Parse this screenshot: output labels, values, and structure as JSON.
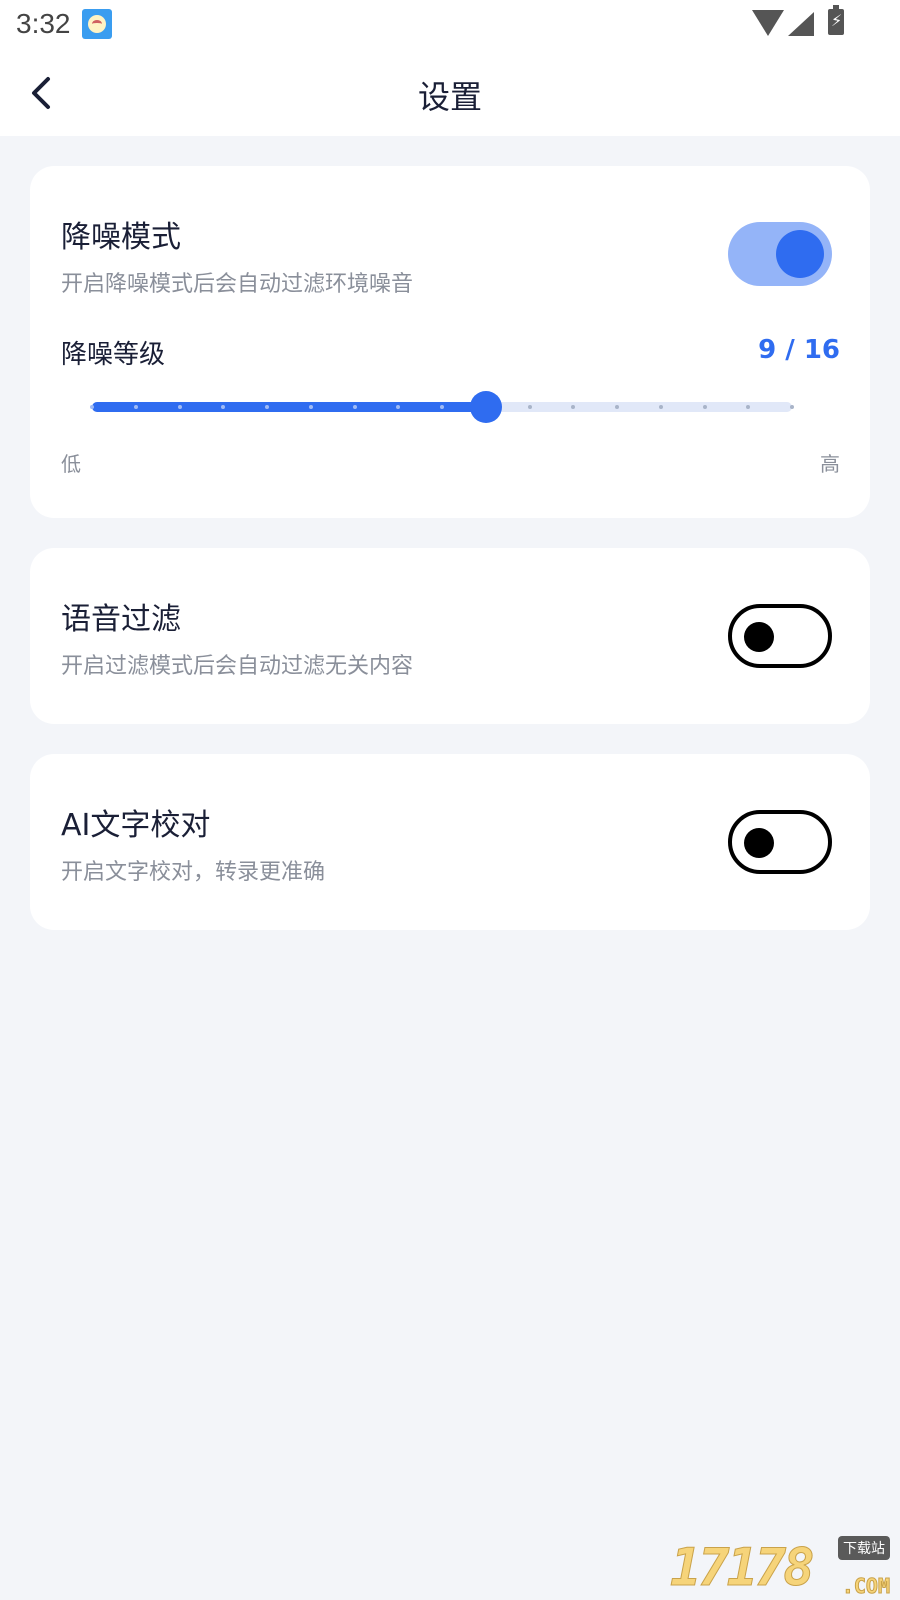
{
  "status_bar": {
    "time": "3:32",
    "app_icon": "bird-app-icon",
    "battery_symbol": "⚡"
  },
  "header": {
    "title": "设置",
    "back_icon": "chevron-left-icon"
  },
  "noise_reduction": {
    "title": "降噪模式",
    "description": "开启降噪模式后会自动过滤环境噪音",
    "enabled": true,
    "level_label": "降噪等级",
    "level_text": "9 / 16",
    "level": 9,
    "level_max": 16,
    "low_label": "低",
    "high_label": "高"
  },
  "voice_filter": {
    "title": "语音过滤",
    "description": "开启过滤模式后会自动过滤无关内容",
    "enabled": false
  },
  "ai_proofread": {
    "title": "AI文字校对",
    "description": "开启文字校对，转录更准确",
    "enabled": false
  },
  "watermark": {
    "digits": "17178",
    "badge": "下载站",
    "domain": ".COM"
  },
  "colors": {
    "accent": "#2f6cf0",
    "accent_light": "#94b4f8",
    "track_inactive": "#e1e8f8",
    "background": "#f3f5f9",
    "title_text": "#1a1f36",
    "secondary_text": "#8a8f9a"
  }
}
